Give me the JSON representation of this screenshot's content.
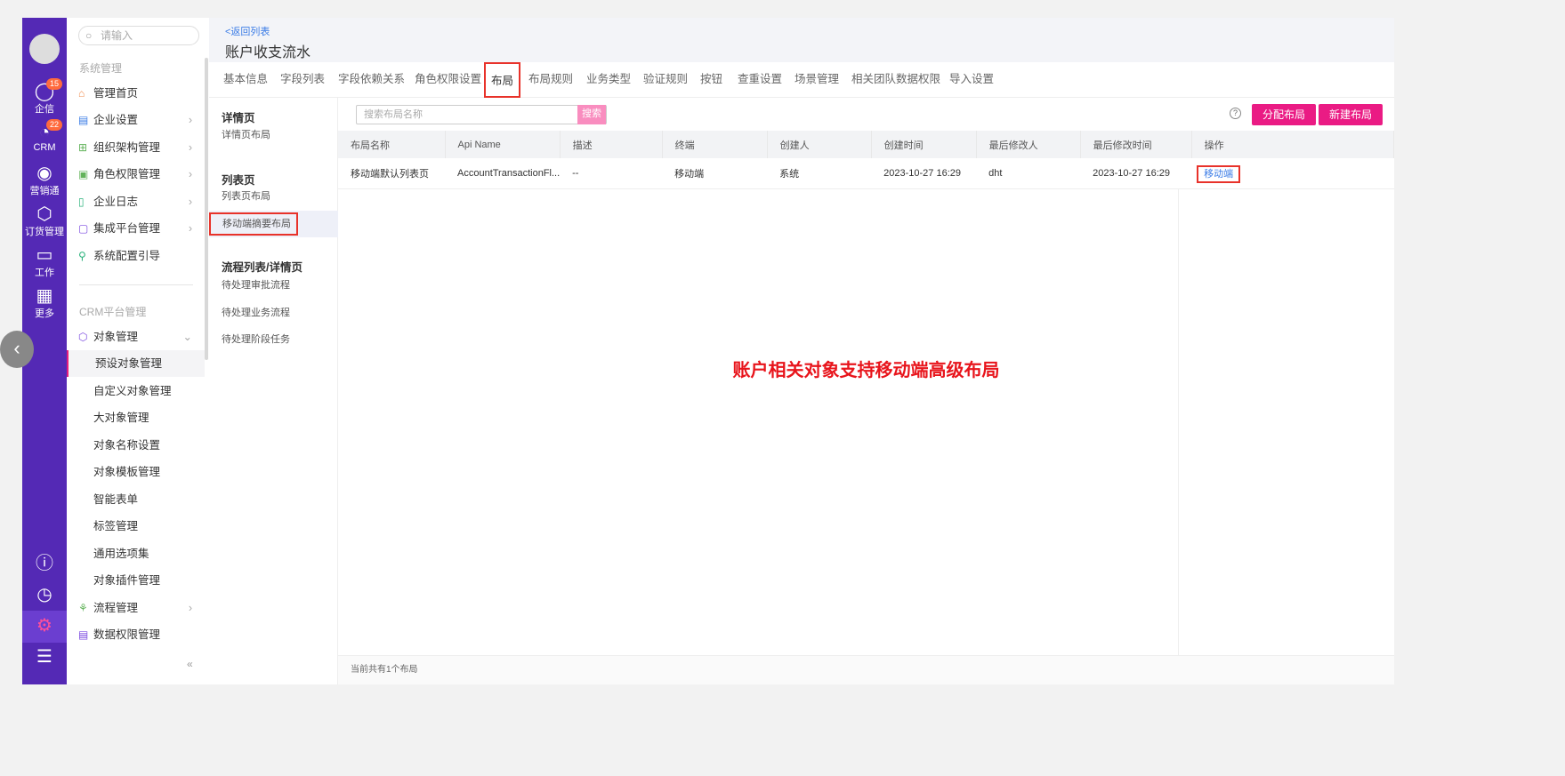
{
  "rail": {
    "items": [
      {
        "label": "企信",
        "badge": "15",
        "icon": "chat-icon"
      },
      {
        "label": "CRM",
        "badge": "22",
        "icon": "pie-icon"
      },
      {
        "label": "营销通",
        "icon": "broadcast-icon"
      },
      {
        "label": "订货管理",
        "icon": "box-icon"
      },
      {
        "label": "工作",
        "icon": "briefcase-icon"
      },
      {
        "label": "更多",
        "icon": "grid-icon"
      }
    ]
  },
  "nav": {
    "search_placeholder": "请输入",
    "section1": "系统管理",
    "items1": [
      {
        "label": "管理首页",
        "color": "#f08a4b"
      },
      {
        "label": "企业设置",
        "color": "#3b7ce6"
      },
      {
        "label": "组织架构管理",
        "color": "#63b35b"
      },
      {
        "label": "角色权限管理",
        "color": "#63b35b"
      },
      {
        "label": "企业日志",
        "color": "#2ab27b"
      },
      {
        "label": "集成平台管理",
        "color": "#7b4ae0"
      },
      {
        "label": "系统配置引导",
        "color": "#2ab27b"
      }
    ],
    "section2": "CRM平台管理",
    "object_mgmt": "对象管理",
    "sub": [
      "预设对象管理",
      "自定义对象管理",
      "大对象管理",
      "对象名称设置",
      "对象模板管理",
      "智能表单",
      "标签管理",
      "通用选项集",
      "对象插件管理"
    ],
    "flow": "流程管理",
    "data_perm": "数据权限管理",
    "collapse": "«"
  },
  "header": {
    "back": "<返回列表",
    "title": "账户收支流水"
  },
  "tabs": [
    "基本信息",
    "字段列表",
    "字段依赖关系",
    "角色权限设置",
    "布局",
    "布局规则",
    "业务类型",
    "验证规则",
    "按钮",
    "查重设置",
    "场景管理",
    "相关团队数据权限",
    "导入设置"
  ],
  "active_tab": "布局",
  "subnav": {
    "g1": "详情页",
    "g1items": [
      "详情页布局"
    ],
    "g2": "列表页",
    "g2items": [
      "列表页布局",
      "移动端摘要布局"
    ],
    "g3": "流程列表/详情页",
    "g3items": [
      "待处理审批流程",
      "待处理业务流程",
      "待处理阶段任务"
    ]
  },
  "toolbar": {
    "search_placeholder": "搜索布局名称",
    "search_btn": "搜索",
    "help": "?",
    "assign": "分配布局",
    "new": "新建布局"
  },
  "table": {
    "headers": [
      "布局名称",
      "Api Name",
      "描述",
      "终端",
      "创建人",
      "创建时间",
      "最后修改人",
      "最后修改时间",
      "操作"
    ],
    "rows": [
      [
        "移动端默认列表页",
        "AccountTransactionFl...",
        "--",
        "移动端",
        "系统",
        "2023-10-27 16:29",
        "dht",
        "2023-10-27 16:29",
        "移动端"
      ]
    ]
  },
  "annotation": "账户相关对象支持移动端高级布局",
  "footer": "当前共有1个布局",
  "colors": {
    "rail": "#5429b5",
    "accent": "#ea1b84",
    "highlight": "#e8322a"
  }
}
